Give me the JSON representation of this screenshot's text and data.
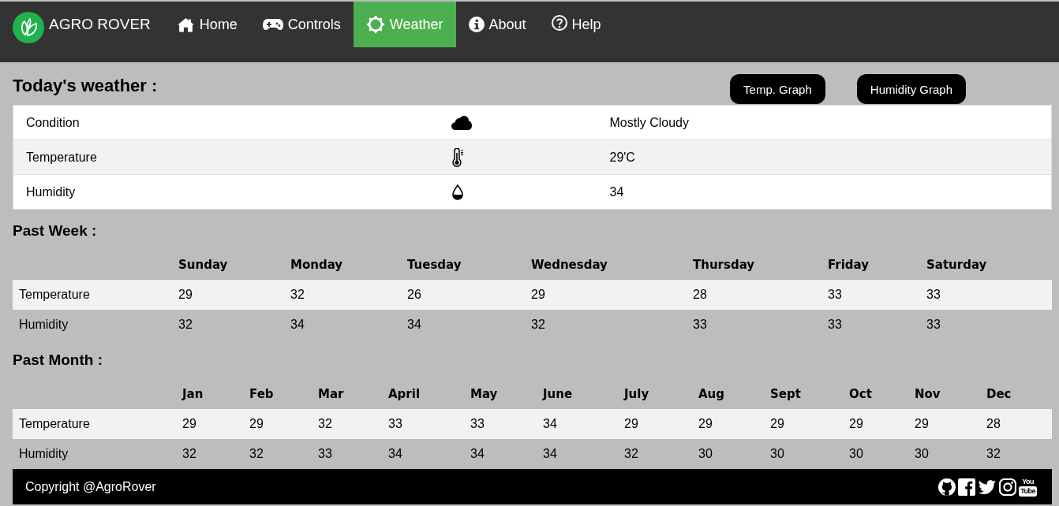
{
  "nav": {
    "brand": "AGRO ROVER",
    "items": [
      {
        "label": "Home",
        "selected": false
      },
      {
        "label": "Controls",
        "selected": false
      },
      {
        "label": "Weather",
        "selected": true
      },
      {
        "label": "About",
        "selected": false
      },
      {
        "label": "Help",
        "selected": false
      }
    ]
  },
  "today": {
    "title": "Today's weather :",
    "buttons": [
      "Temp. Graph",
      "Humidity Graph"
    ],
    "rows": [
      {
        "label": "Condition",
        "value": "Mostly Cloudy"
      },
      {
        "label": "Temperature",
        "value": "29'C"
      },
      {
        "label": "Humidity",
        "value": "34"
      }
    ]
  },
  "past_week": {
    "title": "Past Week :",
    "columns": [
      "Sunday",
      "Monday",
      "Tuesday",
      "Wednesday",
      "Thursday",
      "Friday",
      "Saturday"
    ],
    "rows": [
      {
        "label": "Temperature",
        "values": [
          "29",
          "32",
          "26",
          "29",
          "28",
          "33",
          "33"
        ]
      },
      {
        "label": "Humidity",
        "values": [
          "32",
          "34",
          "34",
          "32",
          "33",
          "33",
          "33"
        ]
      }
    ]
  },
  "past_month": {
    "title": "Past Month :",
    "columns": [
      "Jan",
      "Feb",
      "Mar",
      "April",
      "May",
      "June",
      "July",
      "Aug",
      "Sept",
      "Oct",
      "Nov",
      "Dec"
    ],
    "rows": [
      {
        "label": "Temperature",
        "values": [
          "29",
          "29",
          "32",
          "33",
          "33",
          "34",
          "29",
          "29",
          "29",
          "29",
          "29",
          "28"
        ]
      },
      {
        "label": "Humidity",
        "values": [
          "32",
          "32",
          "33",
          "34",
          "34",
          "34",
          "32",
          "30",
          "30",
          "30",
          "30",
          "32"
        ]
      }
    ]
  },
  "footer": {
    "copyright": "Copyright @AgroRover",
    "social_links": [
      {
        "kind": "github"
      },
      {
        "kind": "facebook"
      },
      {
        "kind": "twitter"
      },
      {
        "kind": "instagram"
      },
      {
        "kind": "youtube",
        "lines": [
          "You",
          "Tube"
        ]
      }
    ]
  }
}
